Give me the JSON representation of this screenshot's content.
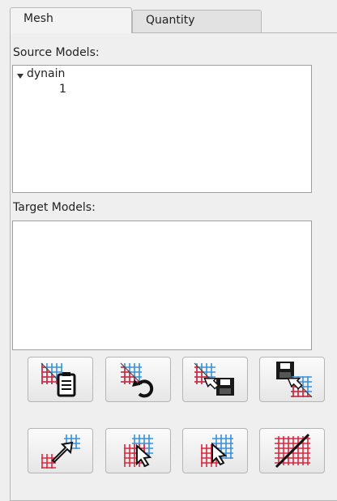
{
  "tabs": [
    {
      "label": "Mesh",
      "active": true
    },
    {
      "label": "Quantity",
      "active": false
    }
  ],
  "source": {
    "label": "Source Models:",
    "tree": [
      {
        "label": "dynain",
        "expanded": true,
        "children": [
          {
            "label": "1"
          }
        ]
      }
    ]
  },
  "target": {
    "label": "Target Models:"
  },
  "toolbar": {
    "row1": [
      {
        "icon": "mesh-clipboard-icon"
      },
      {
        "icon": "mesh-undo-icon"
      },
      {
        "icon": "mesh-save-icon"
      },
      {
        "icon": "save-to-mesh-icon"
      }
    ],
    "row2": [
      {
        "icon": "map-arrow-icon"
      },
      {
        "icon": "select-overlay-icon"
      },
      {
        "icon": "select-blue-mesh-icon"
      },
      {
        "icon": "mesh-slash-icon"
      }
    ]
  },
  "colors": {
    "red_mesh": "#d8283e",
    "blue_mesh": "#3a8fd8"
  }
}
